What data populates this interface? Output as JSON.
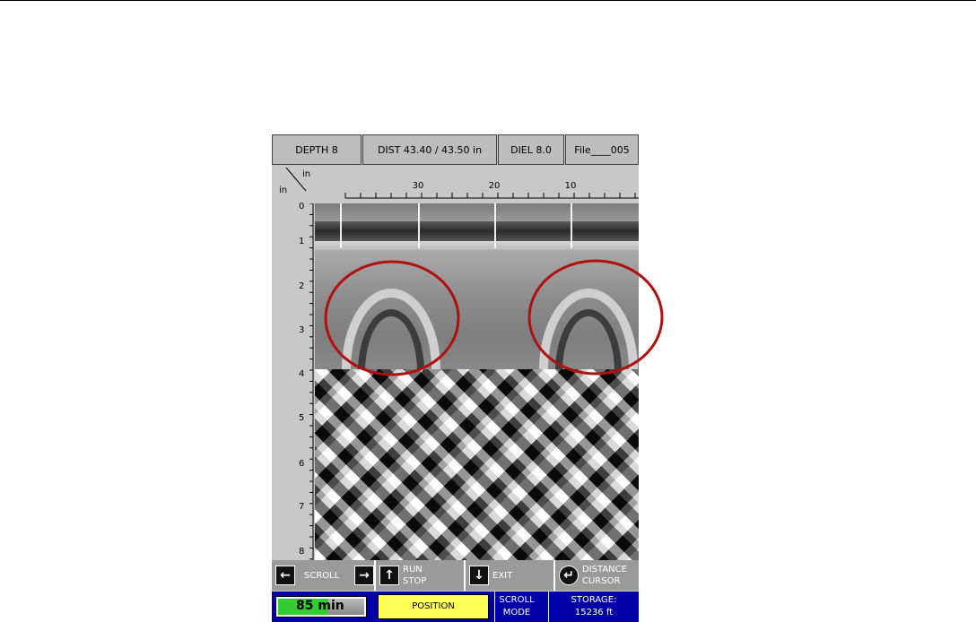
{
  "header": {
    "depth": "DEPTH  8",
    "dist": "DIST 43.40 / 43.50 in",
    "diel": "DIEL 8.0",
    "file": "File____005"
  },
  "axes": {
    "x_unit": "in",
    "y_unit": "in",
    "x_labels": [
      "30",
      "20",
      "10"
    ],
    "y_labels": [
      "0",
      "1",
      "2",
      "3",
      "4",
      "5",
      "6",
      "7",
      "8"
    ]
  },
  "controls": {
    "scroll": "SCROLL",
    "run": "RUN",
    "stop": "STOP",
    "exit": "EXIT",
    "distance": "DISTANCE",
    "cursor": "CURSOR"
  },
  "status": {
    "battery": "85 min",
    "position": "POSITION",
    "scroll": "SCROLL",
    "mode": "MODE",
    "storage_label": "STORAGE:",
    "storage_value": "15236 ft"
  },
  "colors": {
    "annotation_circle": "#b01010",
    "status_bar": "#0000a8",
    "position_button": "#ffff55",
    "battery_fill": "#33cc33"
  },
  "icons": [
    "arrow-left-icon",
    "arrow-right-icon",
    "arrow-up-icon",
    "arrow-down-icon",
    "enter-icon",
    "battery-icon"
  ]
}
